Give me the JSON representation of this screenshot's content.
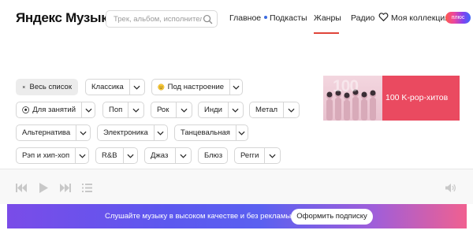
{
  "header": {
    "logo": "Яндекс Музыка",
    "search": {
      "placeholder": "Трек, альбом, исполнитель..."
    },
    "nav": [
      {
        "label": "Главное",
        "dot": true
      },
      {
        "label": "Подкасты"
      },
      {
        "label": "Жанры",
        "active": true
      },
      {
        "label": "Радио"
      },
      {
        "label": "Моя коллекция"
      }
    ],
    "plus_badge": "плюс"
  },
  "genres": {
    "all_label": "Весь список",
    "items": [
      {
        "label": "Классика",
        "dropdown": true
      },
      {
        "label": "Под настроение",
        "dropdown": true,
        "icon": "smiley-icon"
      },
      {
        "label": "Для занятий",
        "dropdown": false,
        "icon": "soccer-ball-icon"
      },
      {
        "label": "Поп",
        "dropdown": true
      },
      {
        "label": "Рок",
        "dropdown": true
      },
      {
        "label": "Инди",
        "dropdown": true
      },
      {
        "label": "Метал",
        "dropdown": true
      },
      {
        "label": "Альтернатива",
        "dropdown": true
      },
      {
        "label": "Электроника",
        "dropdown": true
      },
      {
        "label": "Танцевальная",
        "dropdown": true
      },
      {
        "label": "Рэп и хип-хоп",
        "dropdown": true
      },
      {
        "label": "R&B",
        "dropdown": true
      },
      {
        "label": "Джаз",
        "dropdown": true
      },
      {
        "label": "Блюз",
        "dropdown": false
      },
      {
        "label": "Регги",
        "dropdown": true
      }
    ]
  },
  "banner": {
    "number": "100",
    "title": "100 K-pop-хитов",
    "colors": {
      "background": "#ea4a60"
    }
  },
  "promo": {
    "text": "Слушайте музыку в высоком качестве и без рекламы",
    "button": "Оформить подписку"
  },
  "colors": {
    "accent": "#e0453a",
    "nav_dot": "#3a6be0"
  }
}
